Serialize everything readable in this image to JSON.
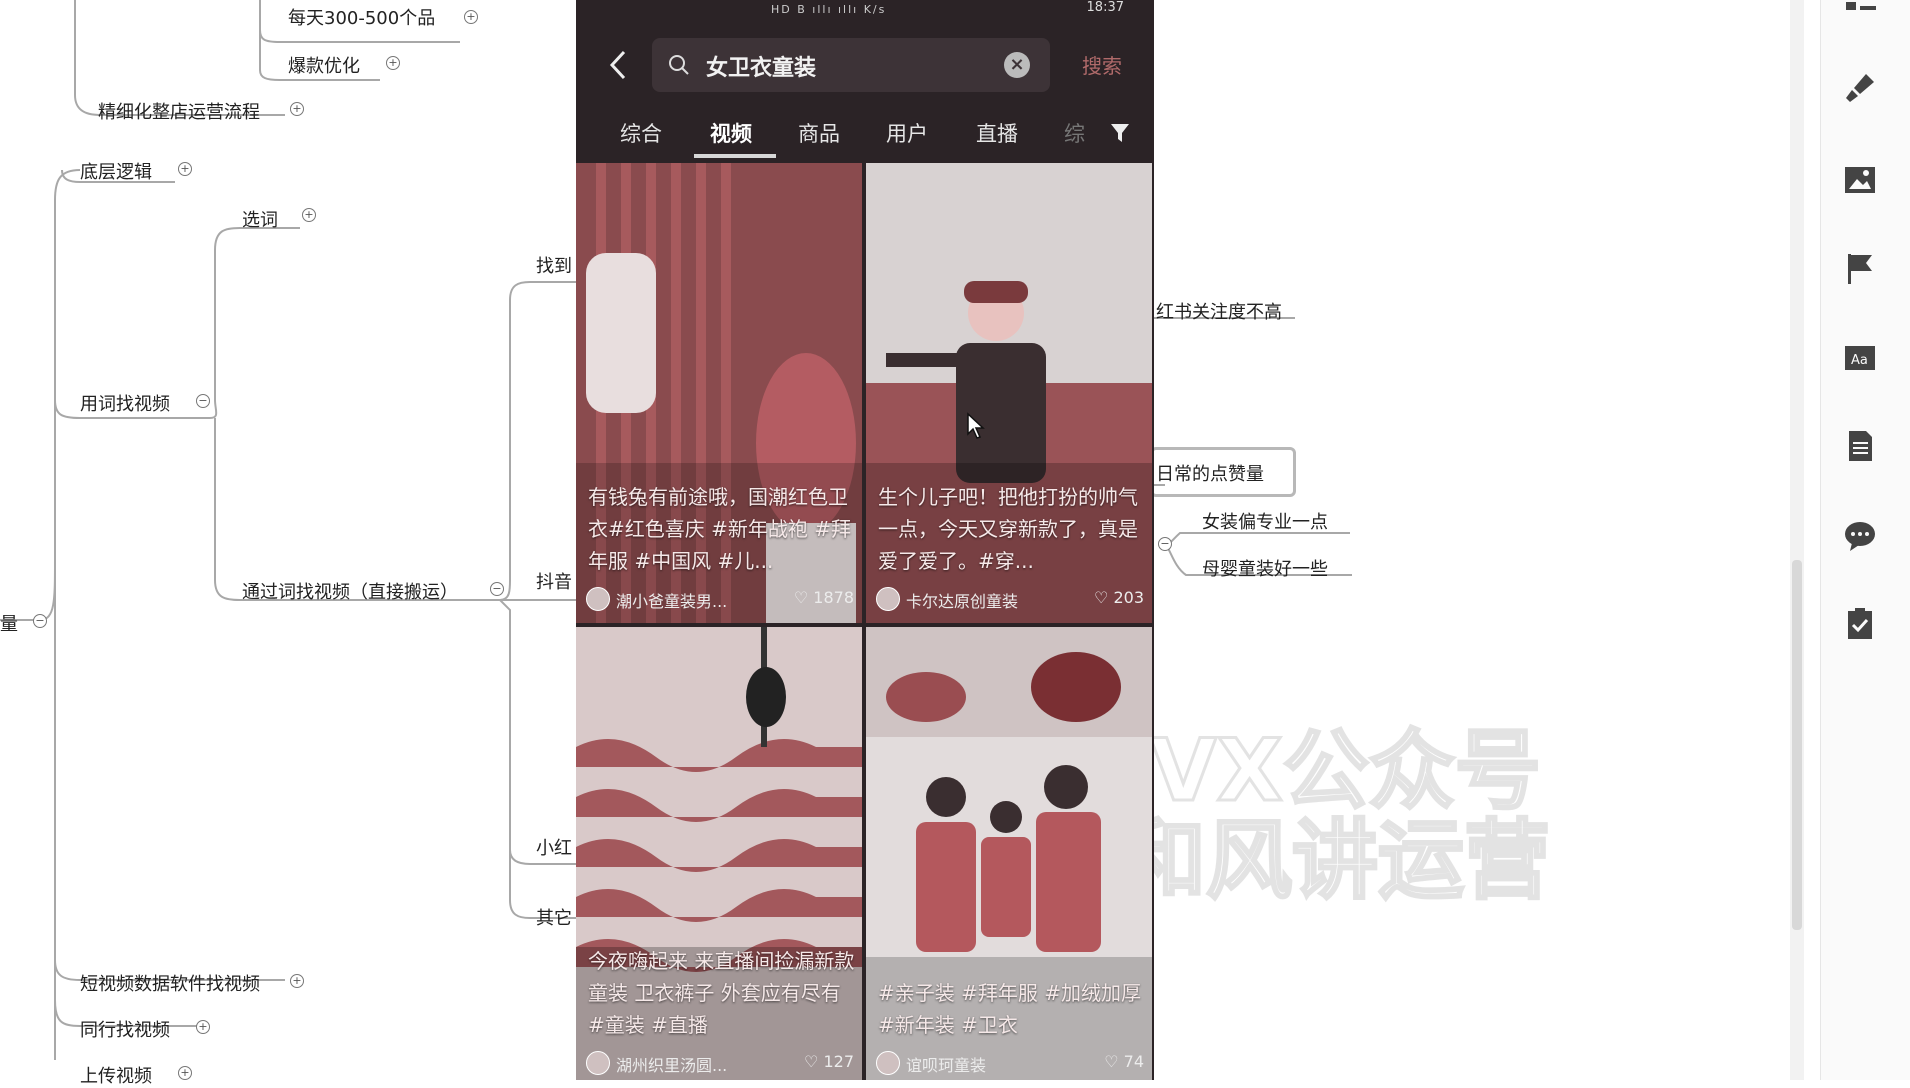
{
  "mindmap": {
    "nodes": {
      "daily_items": "每天300-500个品",
      "hot_optimize": "爆款优化",
      "fine_ops": "精细化整店运营流程",
      "base_logic": "底层逻辑",
      "choose_words": "选词",
      "find_by_word": "用词找视频",
      "find_via_word_direct": "通过词找视频（直接搬运）",
      "find_partial": "找到",
      "douyin": "抖音",
      "xiaohongshu": "小红",
      "other": "其它",
      "root_partial": "量",
      "xhs_low": "红书关注度不高",
      "daily_likes": "日常的点赞量",
      "women_pro": "女装偏专业一点",
      "baby_better": "母婴童装好一些",
      "short_video_tool": "短视频数据软件找视频",
      "peer_video": "同行找视频",
      "upload_video": "上传视频"
    },
    "watermark": {
      "line1": "VX公众号",
      "line2": "和风讲运营"
    }
  },
  "phone": {
    "status": {
      "signal": "HD B  ıllı ıllı  K/s",
      "time": "18:37"
    },
    "search": {
      "query": "女卫衣童装",
      "clear_glyph": "×",
      "button_label": "搜索"
    },
    "tabs": [
      {
        "label": "综合"
      },
      {
        "label": "视频"
      },
      {
        "label": "商品"
      },
      {
        "label": "用户"
      },
      {
        "label": "直播"
      },
      {
        "label": "综"
      }
    ],
    "videos": [
      {
        "caption": "有钱兔有前途哦，国潮红色卫衣#红色喜庆 #新年战袍 #拜年服 #中国风 #儿...",
        "author": "潮小爸童装男...",
        "likes": "♡ 1878"
      },
      {
        "caption": "生个儿子吧！把他打扮的帅气一点，今天又穿新款了，真是爱了爱了。#穿...",
        "author": "卡尔达原创童装",
        "likes": "♡ 203"
      },
      {
        "caption": "今夜嗨起来 来直播间捡漏新款童装 卫衣裤子 外套应有尽有 #童装 #直播",
        "author": "湖州织里汤圆...",
        "likes": "♡ 127"
      },
      {
        "caption": "#亲子装 #拜年服 #加绒加厚 #新年装 #卫衣",
        "author": "谊呗珂童装",
        "likes": "♡ 74"
      }
    ]
  },
  "toolbar": {
    "icons": [
      "structure-icon",
      "brush-icon",
      "image-icon",
      "flag-icon",
      "text-style-icon",
      "note-icon",
      "comment-icon",
      "task-icon"
    ]
  },
  "colors": {
    "phone_bg": "#2b2326",
    "accent_red": "#b06a6a",
    "line_gray": "#9a9a9a"
  }
}
